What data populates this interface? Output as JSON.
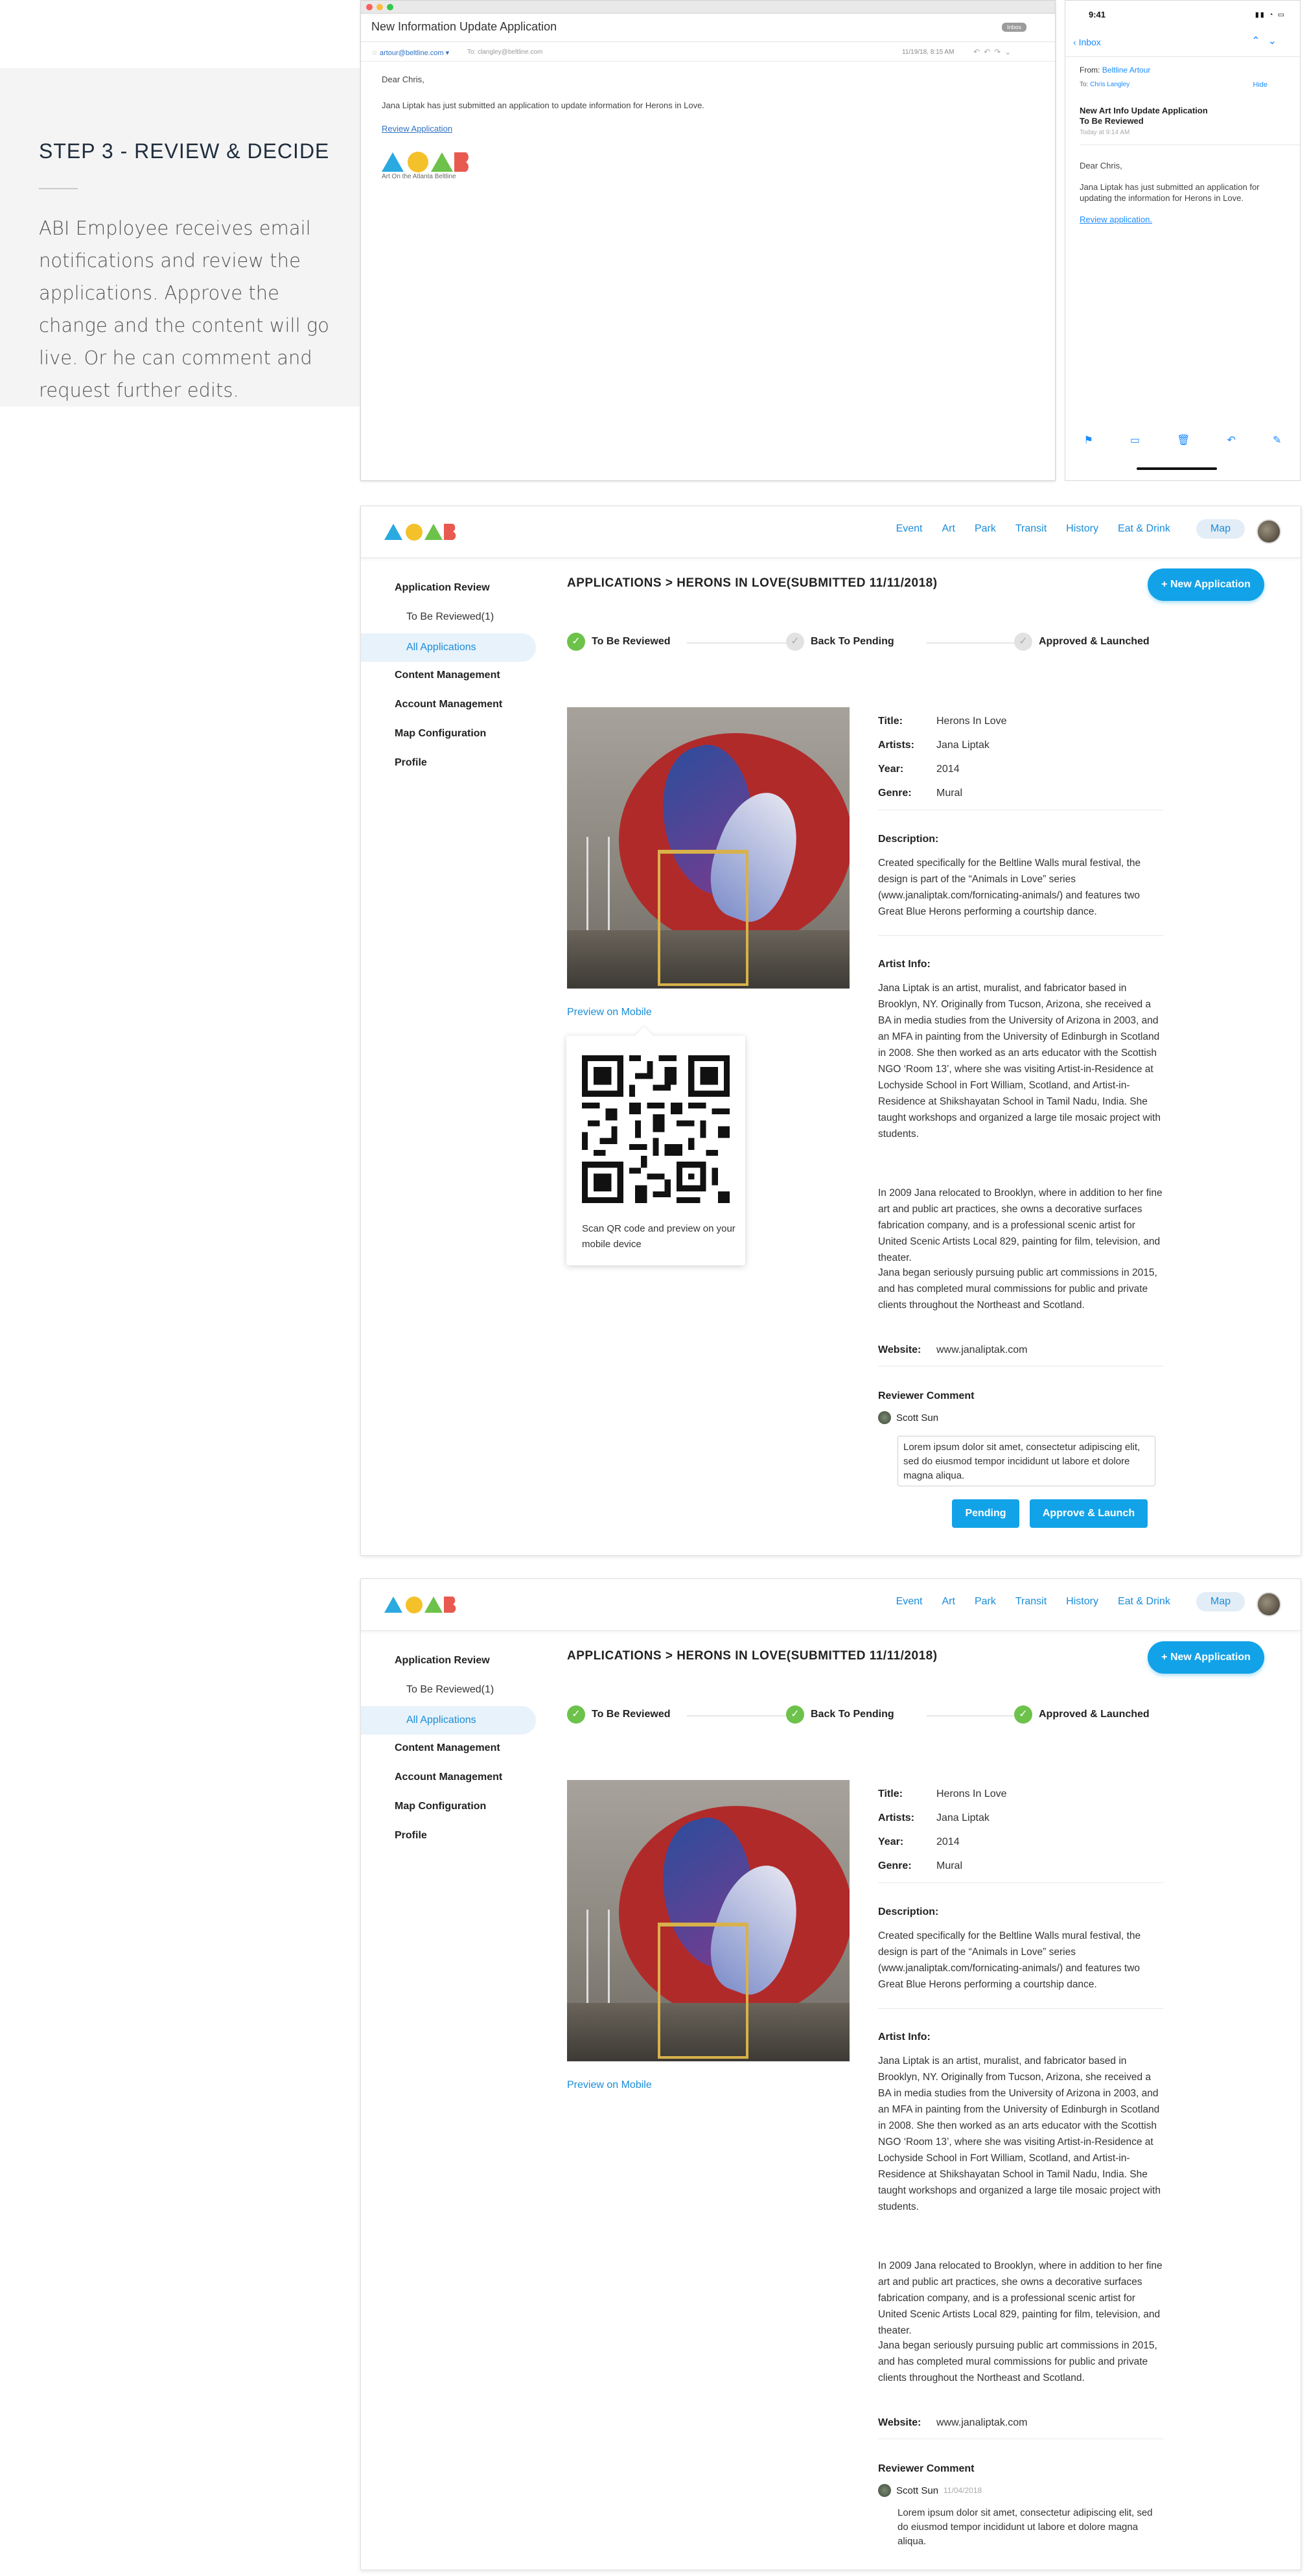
{
  "step": {
    "title": "STEP 3 - REVIEW & DECIDE",
    "text": "ABI Employee receives email notifications and review the applications. Approve the change and the content will go live. Or he can comment and request further edits."
  },
  "mail": {
    "subject": "New Information Update Application",
    "badge": "Inbox",
    "from": "artour@beltline.com",
    "to": "To: clangley@beltline.com",
    "date": "11/19/18, 8:15 AM",
    "greeting": "Dear Chris,",
    "body": "Jana Liptak has just submitted an application to update information for Herons in Love.",
    "link": "Review Application",
    "logo_caption": "Art On the Atlanta Beltline"
  },
  "phone": {
    "time": "9:41",
    "back": "Inbox",
    "from_label": "From:",
    "from_value": "Beltline Artour",
    "to_label": "To:",
    "to_value": "Chris Langley",
    "hide": "Hide",
    "subject": "New Art Info Update Application To Be Reviewed",
    "date": "Today at 9:14 AM",
    "greeting": "Dear Chris,",
    "body": "Jana Liptak has just submitted an application for updating the information for Herons in Love.",
    "link": "Review application."
  },
  "nav": {
    "links": [
      "Event",
      "Art",
      "Park",
      "Transit",
      "History",
      "Eat & Drink"
    ],
    "map": "Map"
  },
  "sidebar": {
    "review": "Application Review",
    "to_review": "To Be Reviewed(1)",
    "all": "All Applications",
    "content": "Content Management",
    "account": "Account Management",
    "map": "Map Configuration",
    "profile": "Profile"
  },
  "breadcrumb": "APPLICATIONS  >  HERONS IN LOVE(SUBMITTED 11/11/2018)",
  "new_button": "+ New Application",
  "steps": [
    "To Be Reviewed",
    "Back To Pending",
    "Approved & Launched"
  ],
  "preview_link": "Preview on Mobile",
  "qr_text": "Scan QR code and preview on your mobile device",
  "detail": {
    "title_label": "Title:",
    "title": "Herons In Love",
    "artists_label": "Artists:",
    "artists": "Jana Liptak",
    "year_label": "Year:",
    "year": "2014",
    "genre_label": "Genre:",
    "genre": "Mural",
    "desc_label": "Description:",
    "desc": "Created specifically for the Beltline Walls mural festival, the design is part of the “Animals in Love” series (www.janaliptak.com/fornicating-animals/) and features two Great Blue Herons performing a courtship dance.",
    "artist_label": "Artist Info:",
    "artist_p1": "Jana Liptak is an artist, muralist, and fabricator based in Brooklyn, NY. Originally from Tucson, Arizona, she received a BA in media studies from the University of Arizona in 2003, and an MFA in painting from the University of Edinburgh in Scotland in 2008. She then worked as an arts educator with the Scottish NGO ‘Room 13’, where she was visiting Artist-in-Residence at Lochyside School in Fort William, Scotland, and Artist-in-Residence at Shikshayatan School in Tamil Nadu, India. She taught workshops and organized a large tile mosaic project with students.",
    "artist_p2": "In 2009 Jana relocated to Brooklyn, where in addition to her fine art and public art practices, she owns a decorative surfaces fabrication company, and is a professional scenic artist for United Scenic Artists Local 829, painting for film, television, and theater.",
    "artist_p3": "Jana began seriously pursuing public art commissions in 2015, and has completed mural commissions for public and private clients throughout the Northeast and Scotland.",
    "website_label": "Website:",
    "website": "www.janaliptak.com",
    "reviewer_label": "Reviewer Comment",
    "reviewer": "Scott Sun",
    "review_date": "11/04/2018",
    "comment": "Lorem ipsum dolor sit amet, consectetur adipiscing elit, sed do eiusmod tempor incididunt ut labore et dolore magna aliqua."
  },
  "buttons": {
    "pending": "Pending",
    "approve": "Approve & Launch"
  },
  "colors": {
    "accent": "#12a2e8",
    "success": "#6cc24a",
    "logo_blue": "#2ba9e1",
    "logo_yellow": "#f4c12a",
    "logo_red": "#e85a4f"
  }
}
